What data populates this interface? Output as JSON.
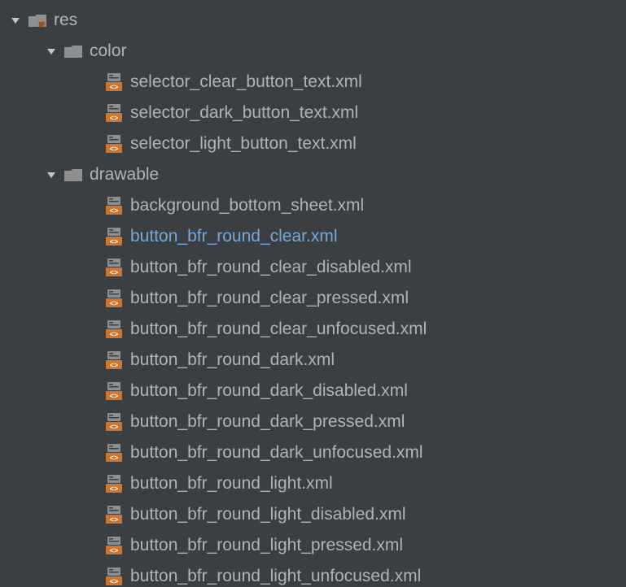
{
  "colors": {
    "bg": "#3b3f41",
    "text": "#b0b4b6",
    "selected": "#7aa8d6",
    "folder": "#8d8f91",
    "xml_icon": "#cf732d",
    "res_strip": "#cf732d"
  },
  "tree": {
    "root": {
      "name": "res",
      "expanded": true,
      "folders": [
        {
          "name": "color",
          "expanded": true,
          "files": [
            "selector_clear_button_text.xml",
            "selector_dark_button_text.xml",
            "selector_light_button_text.xml"
          ]
        },
        {
          "name": "drawable",
          "expanded": true,
          "files": [
            "background_bottom_sheet.xml",
            "button_bfr_round_clear.xml",
            "button_bfr_round_clear_disabled.xml",
            "button_bfr_round_clear_pressed.xml",
            "button_bfr_round_clear_unfocused.xml",
            "button_bfr_round_dark.xml",
            "button_bfr_round_dark_disabled.xml",
            "button_bfr_round_dark_pressed.xml",
            "button_bfr_round_dark_unfocused.xml",
            "button_bfr_round_light.xml",
            "button_bfr_round_light_disabled.xml",
            "button_bfr_round_light_pressed.xml",
            "button_bfr_round_light_unfocused.xml"
          ]
        }
      ]
    },
    "selected_file": "button_bfr_round_clear.xml"
  }
}
